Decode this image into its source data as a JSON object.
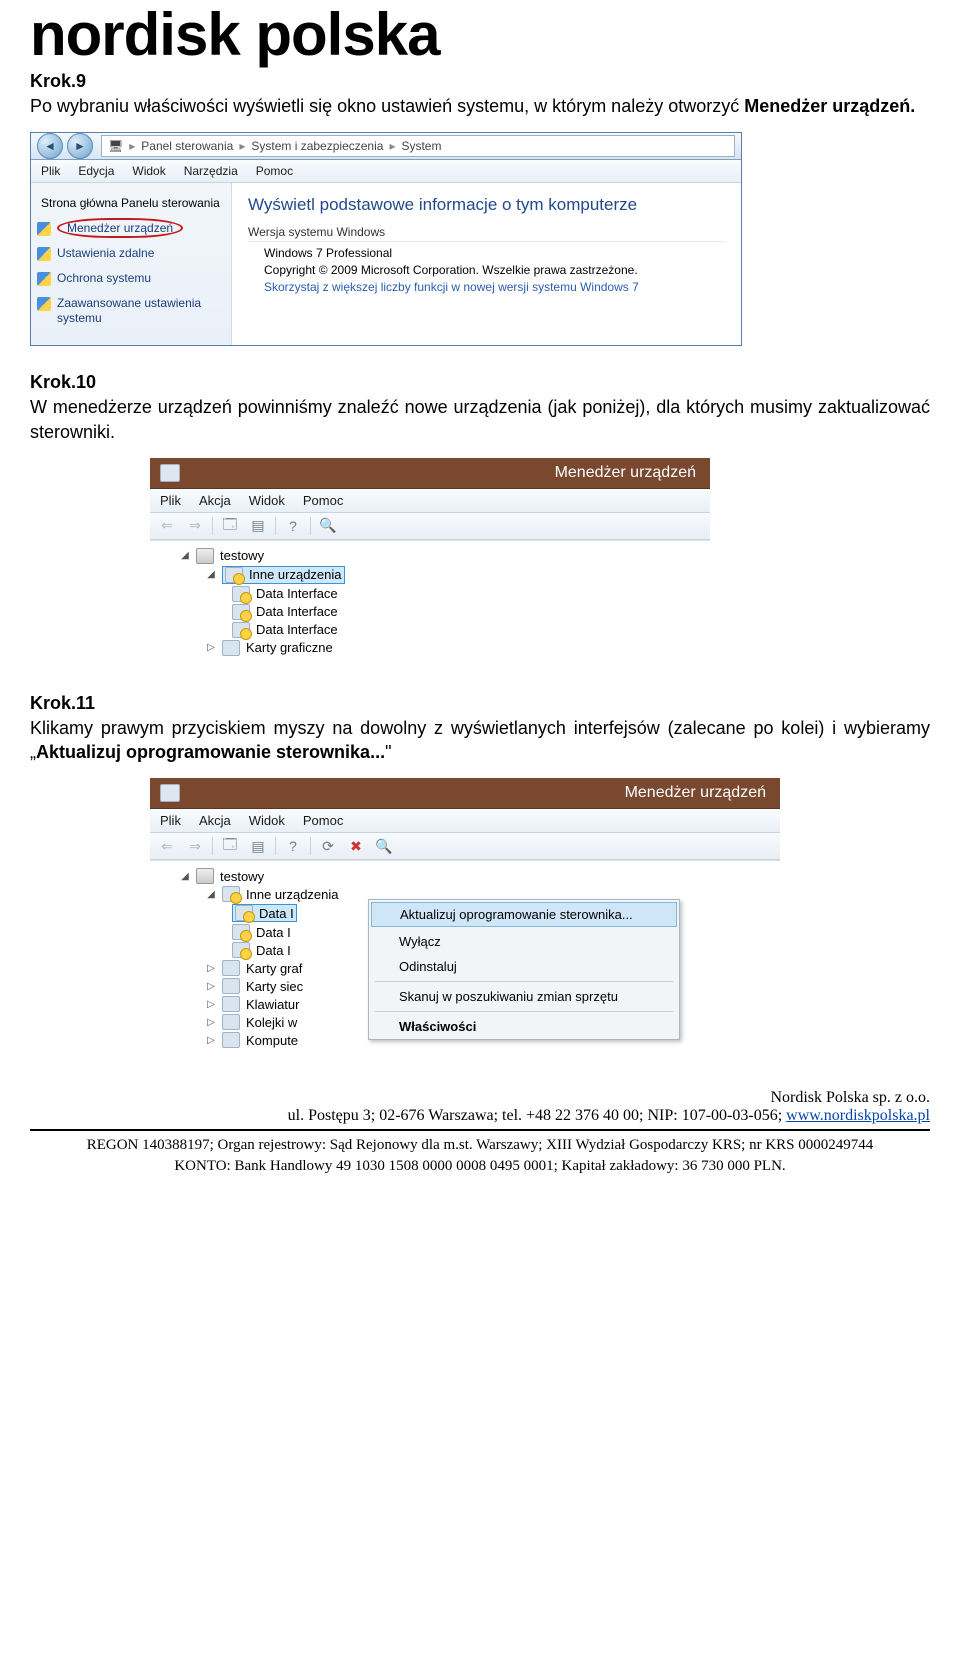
{
  "brand": "nordisk polska",
  "step9": {
    "head": "Krok.9",
    "body_a": "Po wybraniu właściwości wyświetli się okno ustawień systemu, w którym należy otworzyć ",
    "body_b": "Menedżer urządzeń."
  },
  "shot1": {
    "crumb_a": "Panel sterowania",
    "crumb_b": "System i zabezpieczenia",
    "crumb_c": "System",
    "menu": [
      "Plik",
      "Edycja",
      "Widok",
      "Narzędzia",
      "Pomoc"
    ],
    "left_title": "Strona główna Panelu sterowania",
    "left_items": [
      "Menedżer urządzeń",
      "Ustawienia zdalne",
      "Ochrona systemu",
      "Zaawansowane ustawienia systemu"
    ],
    "right_head": "Wyświetl podstawowe informacje o tym komputerze",
    "group1": "Wersja systemu Windows",
    "row1": "Windows 7 Professional",
    "row2": "Copyright © 2009 Microsoft Corporation. Wszelkie prawa zastrzeżone.",
    "row3": "Skorzystaj z większej liczby funkcji w nowej wersji systemu Windows 7"
  },
  "step10": {
    "head": "Krok.10",
    "body": "W menedżerze urządzeń powinniśmy znaleźć nowe urządzenia (jak poniżej), dla których musimy zaktualizować sterowniki."
  },
  "dm": {
    "title": "Menedżer urządzeń",
    "menu": [
      "Plik",
      "Akcja",
      "Widok",
      "Pomoc"
    ],
    "root": "testowy",
    "other": "Inne urządzenia",
    "data_if": "Data Interface",
    "karty_graf": "Karty graficzne",
    "karty_siec": "Karty siec",
    "klaw": "Klawiatur",
    "kolej": "Kolejki w",
    "komp": "Kompute",
    "data_short": "Data I",
    "karty_graf_short": "Karty graf"
  },
  "step11": {
    "head": "Krok.11",
    "body_a": "Klikamy prawym przyciskiem myszy na dowolny z wyświetlanych interfejsów (zalecane po kolei) i wybieramy „",
    "body_b": "Aktualizuj oprogramowanie sterownika...",
    "body_c": "\""
  },
  "ctx": {
    "i1": "Aktualizuj oprogramowanie sterownika...",
    "i2": "Wyłącz",
    "i3": "Odinstaluj",
    "i4": "Skanuj w poszukiwaniu zmian sprzętu",
    "i5": "Właściwości"
  },
  "footer": {
    "company": "Nordisk Polska sp. z o.o.",
    "addr_a": "ul. Postępu 3;  02-676 Warszawa; tel. +48 22 376 40 00; NIP: 107-00-03-056; ",
    "url": "www.nordiskpolska.pl",
    "line2": "REGON 140388197; Organ rejestrowy: Sąd Rejonowy dla m.st. Warszawy; XIII Wydział Gospodarczy KRS; nr KRS 0000249744",
    "line3": "KONTO: Bank Handlowy 49 1030 1508 0000 0008 0495 0001; Kapitał zakładowy: 36 730 000 PLN."
  }
}
